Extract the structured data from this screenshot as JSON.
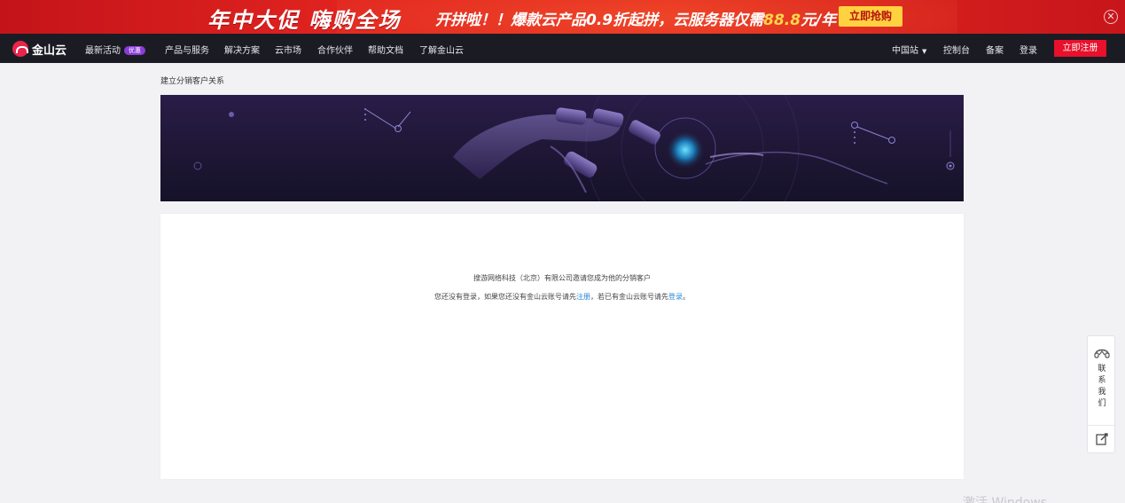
{
  "promo": {
    "title": "年中大促 嗨购全场",
    "subtitle_main": "开拼啦！！爆款云产品0.9折起拼，云服务器仅需",
    "subtitle_price": "88.8",
    "subtitle_unit": "元/年",
    "cta_label": "立即抢购",
    "close_icon": "close-icon"
  },
  "nav": {
    "logo_text": "金山云",
    "items": [
      {
        "label": "最新活动",
        "badge": "优惠"
      },
      {
        "label": "产品与服务"
      },
      {
        "label": "解决方案"
      },
      {
        "label": "云市场"
      },
      {
        "label": "合作伙伴"
      },
      {
        "label": "帮助文档"
      },
      {
        "label": "了解金山云"
      }
    ],
    "region": "中国站",
    "console": "控制台",
    "filing": "备案",
    "login": "登录",
    "signup": "立即注册"
  },
  "breadcrumb": "建立分销客户关系",
  "card": {
    "invite_text": "搜游网络科技（北京）有限公司邀请您成为他的分销客户",
    "login_prefix": "您还没有登录，如果您还没有金山云账号请先",
    "register_link": "注册",
    "login_middle": "，若已有金山云账号请先",
    "login_link": "登录",
    "login_suffix": "。"
  },
  "contact": {
    "label_chars": [
      "联",
      "系",
      "我",
      "们"
    ]
  },
  "watermark": "激活 Windows",
  "colors": {
    "promo_red": "#e0231f",
    "nav_bg": "#1b1b24",
    "signup_red": "#e8102b",
    "link_blue": "#2a86d8",
    "badge_purple": "#8a3dd8"
  }
}
